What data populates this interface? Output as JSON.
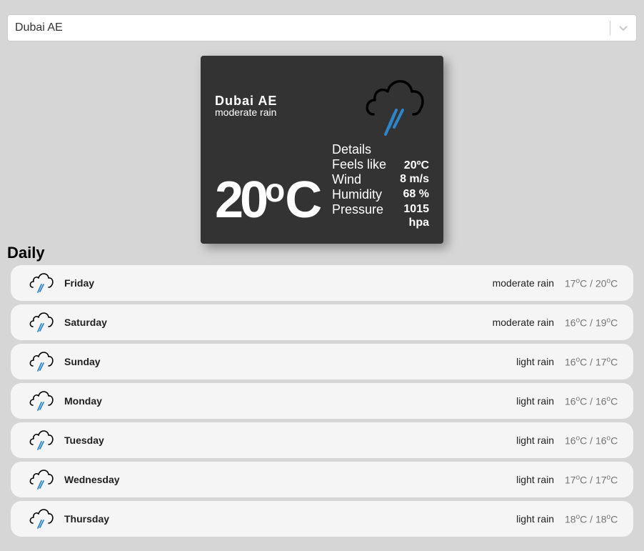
{
  "search": {
    "value": "Dubai AE"
  },
  "current": {
    "city": "Dubai AE",
    "description": "moderate rain",
    "temp": "20",
    "temp_deg": "o",
    "temp_unit": "C",
    "icon": "rain-cloud-icon",
    "details_title": "Details",
    "feels_like_label": "Feels like",
    "feels_like_value": "20ºC",
    "wind_label": "Wind",
    "wind_value": "8 m/s",
    "humidity_label": "Humidity",
    "humidity_value": "68 %",
    "pressure_label": "Pressure",
    "pressure_value": "1015 hpa"
  },
  "daily": {
    "title": "Daily",
    "days": [
      {
        "day": "Friday",
        "desc": "moderate rain",
        "min": "17",
        "max": "20",
        "icon": "rain-cloud-icon"
      },
      {
        "day": "Saturday",
        "desc": "moderate rain",
        "min": "16",
        "max": "19",
        "icon": "rain-cloud-icon"
      },
      {
        "day": "Sunday",
        "desc": "light rain",
        "min": "16",
        "max": "17",
        "icon": "rain-cloud-icon"
      },
      {
        "day": "Monday",
        "desc": "light rain",
        "min": "16",
        "max": "16",
        "icon": "rain-cloud-icon"
      },
      {
        "day": "Tuesday",
        "desc": "light rain",
        "min": "16",
        "max": "16",
        "icon": "rain-cloud-icon"
      },
      {
        "day": "Wednesday",
        "desc": "light rain",
        "min": "17",
        "max": "17",
        "icon": "rain-cloud-icon"
      },
      {
        "day": "Thursday",
        "desc": "light rain",
        "min": "18",
        "max": "18",
        "icon": "rain-cloud-icon"
      }
    ],
    "deg_sup": "o",
    "unit": "C",
    "separator": " / "
  },
  "colors": {
    "rain": "#2e86c9",
    "card_bg": "#333333",
    "row_bg": "#f5f5f5"
  }
}
